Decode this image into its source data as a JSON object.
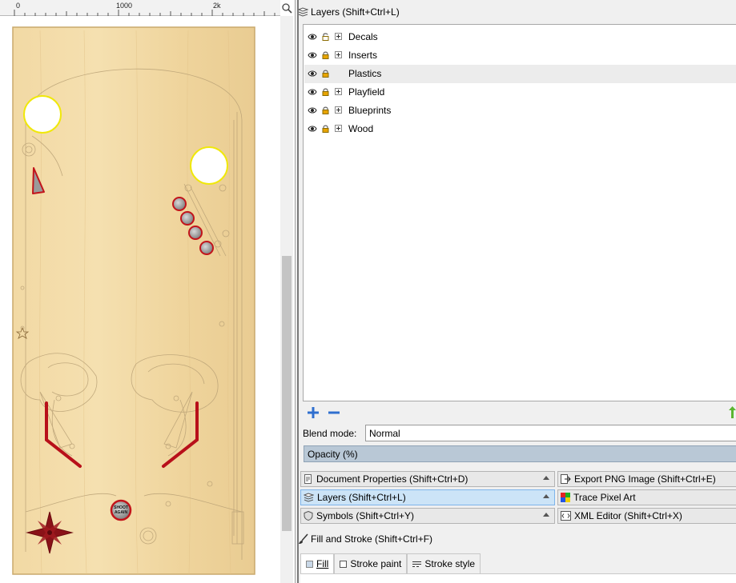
{
  "ruler": {
    "labels": [
      "0",
      "1000",
      "2k"
    ]
  },
  "layers_panel": {
    "title": "Layers (Shift+Ctrl+L)",
    "layers": [
      {
        "name": "Decals",
        "locked": false,
        "expandable": true,
        "selected": false
      },
      {
        "name": "Inserts",
        "locked": true,
        "expandable": true,
        "selected": false
      },
      {
        "name": "Plastics",
        "locked": true,
        "expandable": false,
        "selected": true
      },
      {
        "name": "Playfield",
        "locked": true,
        "expandable": true,
        "selected": false
      },
      {
        "name": "Blueprints",
        "locked": true,
        "expandable": true,
        "selected": false
      },
      {
        "name": "Wood",
        "locked": true,
        "expandable": true,
        "selected": false
      }
    ],
    "blend_label": "Blend mode:",
    "blend_value": "Normal",
    "opacity_label": "Opacity (%)"
  },
  "dock_tabs": {
    "doc_props": "Document Properties (Shift+Ctrl+D)",
    "export_png": "Export PNG Image (Shift+Ctrl+E)",
    "layers": "Layers (Shift+Ctrl+L)",
    "trace_pixel": "Trace Pixel Art",
    "symbols": "Symbols (Shift+Ctrl+Y)",
    "xml_editor": "XML Editor (Shift+Ctrl+X)"
  },
  "fill_stroke": {
    "title": "Fill and Stroke (Shift+Ctrl+F)",
    "tabs": [
      "Fill",
      "Stroke paint",
      "Stroke style"
    ]
  },
  "playfield": {
    "shoot_again": [
      "SHOOT",
      "AGAIN"
    ]
  },
  "colors": {
    "wood": "#f0d7a0",
    "wood_edge": "#c9a96c",
    "accent_red": "#c2141b",
    "highlight_yellow": "#f0e80a",
    "selected_tab": "#cce4f7",
    "opacity_bar": "#b9c8d6"
  }
}
